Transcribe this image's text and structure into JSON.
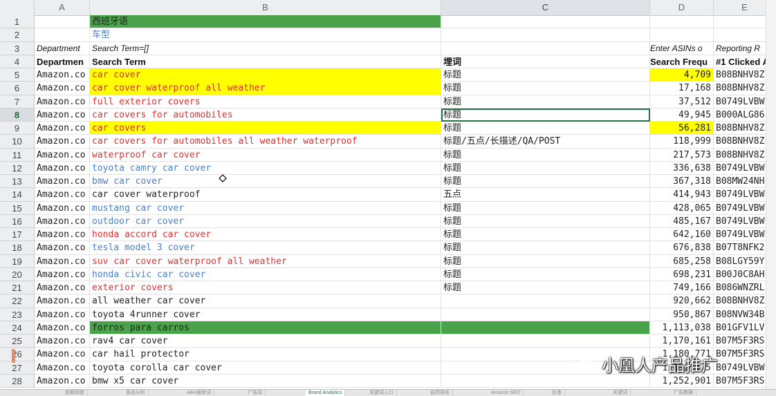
{
  "columns": [
    "A",
    "B",
    "C",
    "D",
    "E"
  ],
  "rows": [
    {
      "n": "1",
      "a": "",
      "b": "西班牙语",
      "b_style": "green",
      "c": "",
      "d": "",
      "e": ""
    },
    {
      "n": "2",
      "a": "",
      "b": "车型",
      "b_style": "bluetext",
      "c": "",
      "d": "",
      "e": ""
    },
    {
      "n": "3",
      "a": "Department",
      "b": "Search Term=[]",
      "b_style": "ital",
      "c": "",
      "d": "Enter ASINs o",
      "e": "Reporting R"
    },
    {
      "n": "4",
      "a": "Departmen",
      "b": "Search Term",
      "b_style": "hdr",
      "c": "埋词",
      "d": "Search Frequ",
      "e": "#1 Clicked A"
    },
    {
      "n": "5",
      "a": "Amazon.co",
      "b": "car cover",
      "b_style": "yellow red",
      "c": "标题",
      "d": "4,709",
      "d_style": "yellow",
      "e": "B08BNHV8Z"
    },
    {
      "n": "6",
      "a": "Amazon.co",
      "b": "car cover waterproof all weather",
      "b_style": "yellow red",
      "c": "标题",
      "d": "17,168",
      "e": "B08BNHV8Z"
    },
    {
      "n": "7",
      "a": "Amazon.co",
      "b": "full exterior covers",
      "b_style": "red",
      "c": "标题",
      "d": "37,512",
      "e": "B0749LVBW"
    },
    {
      "n": "8",
      "a": "Amazon.co",
      "b": "car covers for automobiles",
      "b_style": "red",
      "c": "标题",
      "c_sel": true,
      "d": "49,945",
      "e": "B000ALG86"
    },
    {
      "n": "9",
      "a": "Amazon.co",
      "b": "car covers",
      "b_style": "yellow red",
      "c": "标题",
      "d": "56,281",
      "d_style": "yellow",
      "e": "B08BNHV8Z"
    },
    {
      "n": "10",
      "a": "Amazon.co",
      "b": "car covers for automobiles all weather waterproof",
      "b_style": "red",
      "c": "标题/五点/长描述/QA/POST",
      "d": "118,999",
      "e": "B08BNHV8Z"
    },
    {
      "n": "11",
      "a": "Amazon.co",
      "b": "waterproof car cover",
      "b_style": "red",
      "c": "标题",
      "d": "217,573",
      "e": "B08BNHV8Z"
    },
    {
      "n": "12",
      "a": "Amazon.co",
      "b": "toyota camry car cover",
      "b_style": "blue",
      "c": "标题",
      "d": "336,638",
      "e": "B0749LVBW"
    },
    {
      "n": "13",
      "a": "Amazon.co",
      "b": "bmw car cover",
      "b_style": "blue",
      "c": "标题",
      "d": "367,318",
      "e": "B08MW24NH"
    },
    {
      "n": "14",
      "a": "Amazon.co",
      "b": "car cover waterproof",
      "b_style": "",
      "c": "五点",
      "d": "414,943",
      "e": "B0749LVBW"
    },
    {
      "n": "15",
      "a": "Amazon.co",
      "b": "mustang car cover",
      "b_style": "blue",
      "c": "标题",
      "d": "428,065",
      "e": "B0749LVBW"
    },
    {
      "n": "16",
      "a": "Amazon.co",
      "b": "outdoor car cover",
      "b_style": "blue",
      "c": "标题",
      "d": "485,167",
      "e": "B0749LVBW"
    },
    {
      "n": "17",
      "a": "Amazon.co",
      "b": "honda accord car cover",
      "b_style": "red",
      "c": "标题",
      "d": "642,160",
      "e": "B0749LVBW"
    },
    {
      "n": "18",
      "a": "Amazon.co",
      "b": "tesla model 3 cover",
      "b_style": "blue",
      "c": "标题",
      "d": "676,838",
      "e": "B07T8NFK2"
    },
    {
      "n": "19",
      "a": "Amazon.co",
      "b": "suv car cover waterproof all weather",
      "b_style": "red",
      "c": "标题",
      "d": "685,258",
      "e": "B08LGY59Y"
    },
    {
      "n": "20",
      "a": "Amazon.co",
      "b": "honda civic car cover",
      "b_style": "blue",
      "c": "标题",
      "d": "698,231",
      "e": "B00J0C8AH"
    },
    {
      "n": "21",
      "a": "Amazon.co",
      "b": "exterior covers",
      "b_style": "red",
      "c": "标题",
      "d": "749,166",
      "e": "B086WNZRL"
    },
    {
      "n": "22",
      "a": "Amazon.co",
      "b": "all weather car cover",
      "b_style": "",
      "c": "",
      "d": "920,662",
      "e": "B08BNHV8Z"
    },
    {
      "n": "23",
      "a": "Amazon.co",
      "b": "toyota 4runner cover",
      "b_style": "",
      "c": "",
      "d": "950,867",
      "e": "B08NVW34B"
    },
    {
      "n": "24",
      "a": "Amazon.co",
      "b": "forros para carros",
      "b_style": "green",
      "c": "",
      "c_style": "green",
      "d": "1,113,038",
      "e": "B01GFV1LV"
    },
    {
      "n": "25",
      "a": "Amazon.co",
      "b": "rav4 car cover",
      "b_style": "",
      "c": "",
      "d": "1,170,161",
      "e": "B07M5F3RS"
    },
    {
      "n": "26",
      "a": "Amazon.co",
      "b": "car hail protector",
      "b_style": "",
      "c": "",
      "d": "1,180,771",
      "e": "B07M5F3RS"
    },
    {
      "n": "27",
      "a": "Amazon.co",
      "b": "toyota corolla car cover",
      "b_style": "",
      "c": "",
      "d": "1,192,475",
      "e": "B0749LVBW"
    },
    {
      "n": "28",
      "a": "Amazon.co",
      "b": "bmw x5 car cover",
      "b_style": "",
      "c": "",
      "d": "1,252,901",
      "e": "B07M5F3RS"
    }
  ],
  "selected_row": "8",
  "selected_column": "C",
  "sheet_tabs": [
    "前期调查",
    "竞品分析",
    "ABA搜索词",
    "广告词",
    "Brand Analytics",
    "关键词入口",
    "自然排名",
    "Amazon SEO",
    "反查",
    "关键词",
    "广告数据"
  ],
  "active_tab_index": 4,
  "watermark": "小凰人产品推广",
  "colors": {
    "highlight_yellow": "#ffff00",
    "highlight_green": "#4aa34a",
    "text_red": "#e03030",
    "text_blue": "#4a7fc8",
    "select_green": "#217346"
  }
}
